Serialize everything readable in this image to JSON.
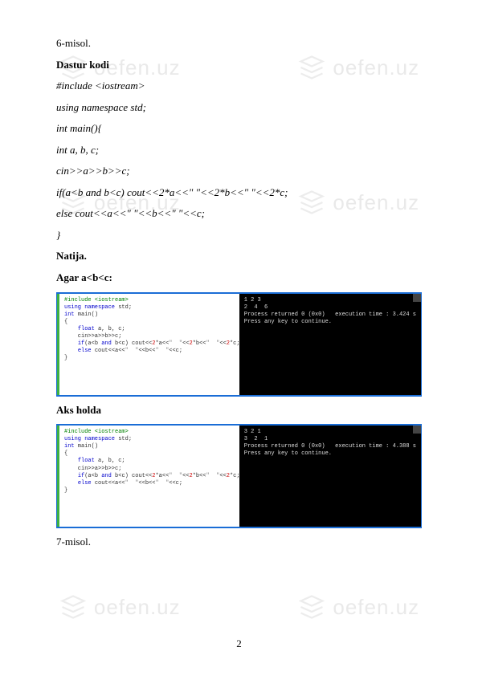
{
  "watermark_text": "oefen.uz",
  "task_label": "6-misol.",
  "header_code": "Dastur kodi",
  "code_lines": [
    "#include <iostream>",
    "using namespace std;",
    "int main(){",
    " int a, b, c;",
    " cin>>a>>b>>c;",
    " if(a<b and b<c) cout<<2*a<<\"  \"<<2*b<<\"  \"<<2*c;",
    " else cout<<a<<\"  \"<<b<<\"  \"<<c;",
    "}"
  ],
  "result_label": "Natija.",
  "case1_label": "Agar a<b<c:",
  "case2_label": "Aks holda",
  "next_task": "7-misol.",
  "page_number": "2",
  "editor_code": {
    "l1": "#include <iostream>",
    "l2": "using namespace std;",
    "l3": "int main()",
    "l4": "{",
    "l5": "    float a, b, c;",
    "l6": "    cin>>a>>b>>c;",
    "l7": "    if(a<b and b<c) cout<<2*a<<\"  \"<<2*b<<\"  \"<<2*c;",
    "l8": "    else cout<<a<<\"  \"<<b<<\"  \"<<c;",
    "l9": "}"
  },
  "terminal1": {
    "l1": "1 2 3",
    "l2": "2  4  6",
    "l3": "Process returned 0 (0x0)   execution time : 3.424 s",
    "l4": "Press any key to continue."
  },
  "terminal2": {
    "l1": "3 2 1",
    "l2": "3  2  1",
    "l3": "Process returned 0 (0x0)   execution time : 4.388 s",
    "l4": "Press any key to continue."
  }
}
